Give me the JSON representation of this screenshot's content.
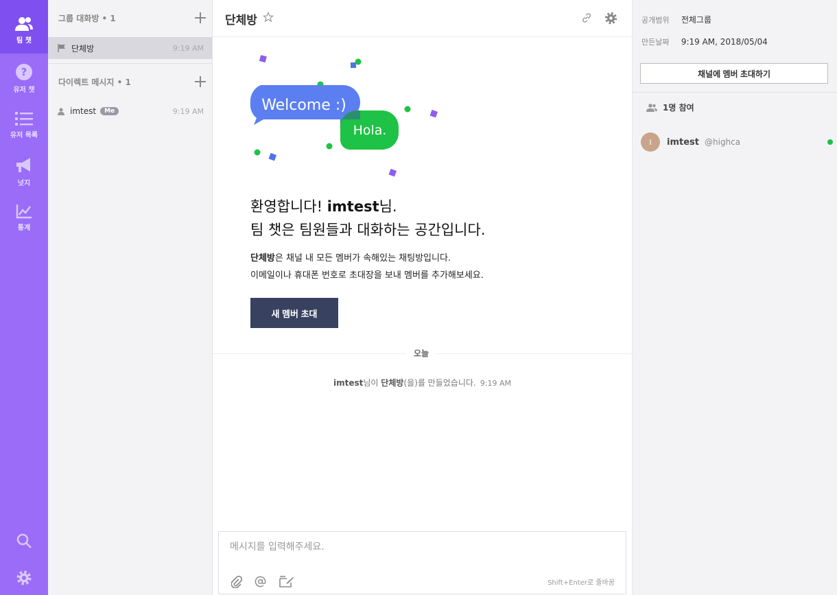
{
  "rail": {
    "items": [
      {
        "label": "팀 챗",
        "icon": "team-chat-icon"
      },
      {
        "label": "유저 챗",
        "icon": "user-chat-icon"
      },
      {
        "label": "유저 목록",
        "icon": "user-list-icon"
      },
      {
        "label": "넛지",
        "icon": "nudge-icon"
      },
      {
        "label": "통계",
        "icon": "stats-icon"
      }
    ],
    "bottom_icons": [
      "search-icon",
      "gear-icon"
    ],
    "colors": {
      "background": "#9a6cf7",
      "active": "#7f4ff0"
    }
  },
  "sidebar": {
    "group_header": "그룹 대화방 • 1",
    "groups": [
      {
        "name": "단체방",
        "time": "9:19 AM",
        "icon": "flag-icon"
      }
    ],
    "direct_header": "다이렉트 메시지 • 1",
    "directs": [
      {
        "name": "imtest",
        "badge": "Me",
        "time": "9:19 AM",
        "icon": "person-icon"
      }
    ]
  },
  "main": {
    "title": "단체방",
    "welcome_bubble": "Welcome :)",
    "hola_bubble": "Hola.",
    "heading_prefix": "환영합니다! ",
    "heading_user": "imtest",
    "heading_suffix": "님.",
    "heading_line2": "팀 챗은 팀원들과 대화하는 공간입니다.",
    "desc_bold": "단체방",
    "desc_line1_rest": "은 채널 내 모든 멤버가 속해있는 채팅방입니다.",
    "desc_line2": "이메일이나 휴대폰 번호로 초대장을 보내 멤버를 추가해보세요.",
    "invite_button": "새 멤버 초대",
    "day_label": "오늘",
    "sys_user": "imtest",
    "sys_mid": "님이 ",
    "sys_room": "단체방",
    "sys_end": "(을)를 만들었습니다.",
    "sys_time": "9:19 AM",
    "composer_placeholder": "메시지를 입력해주세요.",
    "composer_hint": "Shift+Enter로 줄바꿈",
    "colors": {
      "invite_bg": "#394160",
      "welcome_blue": "#5b7ff1",
      "hola_green": "#1ec246"
    }
  },
  "right": {
    "visibility_key": "공개범위",
    "visibility_value": "전체그룹",
    "created_key": "만든날짜",
    "created_value": "9:19 AM, 2018/05/04",
    "invite_button": "채널에 멤버 초대하기",
    "members_count": "1명 참여",
    "members": [
      {
        "initial": "I",
        "name": "imtest",
        "handle": "@highca",
        "status": "online"
      }
    ]
  }
}
